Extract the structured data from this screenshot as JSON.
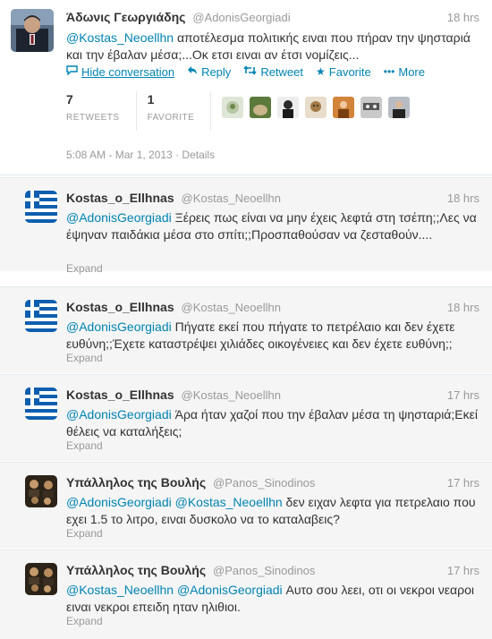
{
  "main_tweet": {
    "display_name": "Άδωνις Γεωργιάδης",
    "handle": "@AdonisGeorgiadi",
    "time": "18 hrs",
    "mention": "@Kostas_Neoellhn",
    "text": " αποτέλεσμα πολιτικής ειναι που πήραν την ψησταριά και την έβαλαν μέσα;...Οκ ετσι ειναι αν έτσι νομίζεις...",
    "actions": {
      "hide": "Hide conversation",
      "reply": "Reply",
      "retweet": "Retweet",
      "favorite": "Favorite",
      "more": "More"
    },
    "stats": {
      "retweets_count": "7",
      "retweets_label": "RETWEETS",
      "favorites_count": "1",
      "favorites_label": "FAVORITE"
    },
    "timestamp": "5:08 AM - Mar 1, 2013",
    "details": "Details"
  },
  "replies": [
    {
      "display_name": "Kostas_o_Ellhnas",
      "handle": "@Kostas_Neoellhn",
      "time": "18 hrs",
      "mention": "@AdonisGeorgiadi",
      "text": " Ξέρεις πως είναι να μην έχεις λεφτά στη τσέπη;;Λες να έψηναν παιδάκια μέσα στο σπίτι;;Προσπαθούσαν να ζεσταθούν....",
      "expand": "Expand"
    },
    {
      "display_name": "Kostas_o_Ellhnas",
      "handle": "@Kostas_Neoellhn",
      "time": "18 hrs",
      "mention": "@AdonisGeorgiadi",
      "text": " Πήγατε εκεί που πήγατε το πετρέλαιο και δεν έχετε ευθύνη;;Έχετε καταστρέψει χιλιάδες οικογένειες και δεν έχετε ευθύνη;;",
      "expand": "Expand"
    },
    {
      "display_name": "Kostas_o_Ellhnas",
      "handle": "@Kostas_Neoellhn",
      "time": "17 hrs",
      "mention": "@AdonisGeorgiadi",
      "text": " Άρα ήταν χαζοί που την έβαλαν μέσα τη ψησταριά;Εκεί θέλεις να καταλήξεις;",
      "expand": "Expand"
    },
    {
      "display_name": "Υπάλληλος της Βουλής",
      "handle": "@Panos_Sinodinos",
      "time": "17 hrs",
      "mention": "@AdonisGeorgiadi @Kostas_Neoellhn",
      "text": " δεν ειχαν λεφτα για πετρελαιο που εχει 1.5 το λιτρο, ειναι δυσκολο να το καταλαβεις?",
      "expand": "Expand"
    },
    {
      "display_name": "Υπάλληλος της Βουλής",
      "handle": "@Panos_Sinodinos",
      "time": "17 hrs",
      "mention": "@Kostas_Neoellhn @AdonisGeorgiadi",
      "text": " Αυτο σου λεει, οτι οι νεκροι νεαροι ειναι νεκροι επειδη ηταν ηλιθιοι.",
      "expand": "Expand"
    }
  ],
  "colors": {
    "link": "#0084b4",
    "muted": "#999999",
    "reply_bg": "#f5f5f5"
  }
}
